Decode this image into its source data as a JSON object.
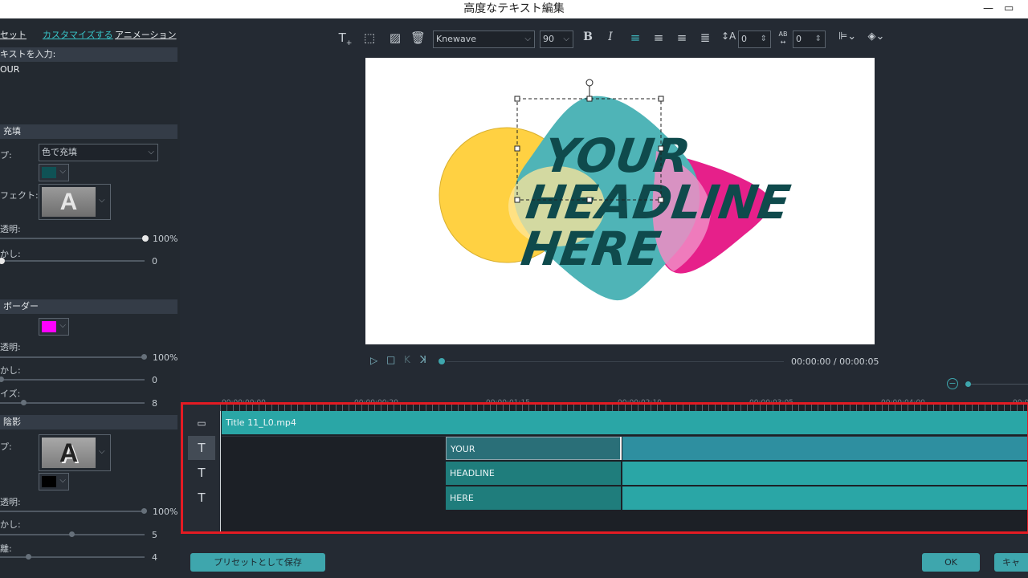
{
  "window": {
    "title": "高度なテキスト編集",
    "minimize_icon": "minimize-icon",
    "restore_icon": "restore-icon"
  },
  "left_tabs": [
    "セット",
    "カスタマイズする",
    "アニメーション"
  ],
  "text_input": {
    "label": "キストを入力:",
    "value": "OUR"
  },
  "fill": {
    "header": "充填",
    "type_label": "プ:",
    "type_value": "色で充填",
    "color": "#0f5255",
    "effect_label": "フェクト:",
    "effect_glyph": "A",
    "opacity_label": "透明:",
    "opacity_value": "100%",
    "blur_label": "かし:",
    "blur_value": "0"
  },
  "border": {
    "header": "ボーダー",
    "color": "#ff00ff",
    "opacity_label": "透明:",
    "opacity_value": "100%",
    "blur_label": "かし:",
    "blur_value": "0",
    "size_label": "イズ:",
    "size_value": "8"
  },
  "shadow": {
    "header": "陰影",
    "type_label": "プ:",
    "type_glyph": "A",
    "color": "#000000",
    "opacity_label": "透明:",
    "opacity_value": "100%",
    "blur_label": "かし:",
    "blur_value": "5",
    "dist_label": "離:",
    "dist_value": "4"
  },
  "toolbar": {
    "font": "Knewave",
    "font_size": "90",
    "bold": "B",
    "italic": "I",
    "line_spacing": "0",
    "char_spacing": "0",
    "char_spacing_label": "AB"
  },
  "preview": {
    "line1": "YOUR",
    "line2": "HEADLINE",
    "line3": "HERE"
  },
  "transport": {
    "time": "00:00:00 / 00:00:05"
  },
  "timeline": {
    "ruler": [
      "00:00:00:00",
      "00:00:00:20",
      "00:00:01:15",
      "00:00:02:10",
      "00:00:03:05",
      "00:00:04:00",
      "00:00:0"
    ],
    "video_clip": "Title 11_L0.mp4",
    "text_clips": [
      "YOUR",
      "HEADLINE",
      "HERE"
    ]
  },
  "buttons": {
    "save_preset": "プリセットとして保存",
    "ok": "OK",
    "cancel": "キャンセ"
  },
  "colors": {
    "accent": "#2aa6a6",
    "highlight_border": "#e41b23",
    "teal_shape": "#4fb4b7",
    "yellow_shape": "#ffd142",
    "pink_shape": "#e6208a",
    "text_fill": "#0f4a4c"
  }
}
